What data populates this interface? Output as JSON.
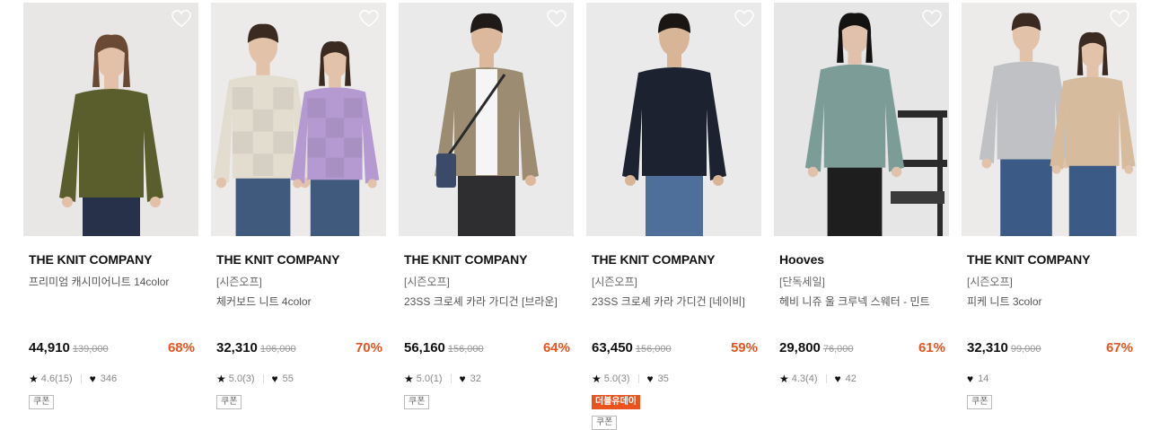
{
  "products": [
    {
      "brand": "THE KNIT COMPANY",
      "tag": "",
      "name": "프리미엄 캐시미어니트 14color",
      "price": "44,910",
      "original": "139,000",
      "discount": "68%",
      "rating": "4.6(15)",
      "likes": "346",
      "badges": [
        "쿠폰"
      ],
      "colors": {
        "bg": "#e9e7e6",
        "garment": "#5a5e2c",
        "pants": "#27314a",
        "skin": "#e3c0a8",
        "hair": "#6b4a35"
      }
    },
    {
      "brand": "THE KNIT COMPANY",
      "tag": "[시즌오프]",
      "name": "체커보드 니트 4color",
      "price": "32,310",
      "original": "106,000",
      "discount": "70%",
      "rating": "5.0(3)",
      "likes": "55",
      "badges": [
        "쿠폰"
      ],
      "colors": {
        "bg": "#ecebea",
        "garment": "#e3ddd0",
        "garment2": "#b49ad0",
        "pants": "#3f5a7d",
        "skin": "#e3c2aa",
        "hair": "#3a2a20"
      }
    },
    {
      "brand": "THE KNIT COMPANY",
      "tag": "[시즌오프]",
      "name": "23SS 크로셰 카라 가디건 [브라운]",
      "price": "56,160",
      "original": "156,000",
      "discount": "64%",
      "rating": "5.0(1)",
      "likes": "32",
      "badges": [
        "쿠폰"
      ],
      "colors": {
        "bg": "#ebeaea",
        "garment": "#9c8c72",
        "inner": "#f5f5f5",
        "pants": "#2e2e30",
        "skin": "#dcb99c",
        "hair": "#1f1a18"
      }
    },
    {
      "brand": "THE KNIT COMPANY",
      "tag": "[시즌오프]",
      "name": "23SS 크로셰 카라 가디건 [네이비]",
      "price": "63,450",
      "original": "156,000",
      "discount": "59%",
      "rating": "5.0(3)",
      "likes": "35",
      "badges": [
        "더블유데이",
        "쿠폰"
      ],
      "colors": {
        "bg": "#ebeaea",
        "garment": "#1c2230",
        "pants": "#4d6f9a",
        "skin": "#d9b598",
        "hair": "#1a1614"
      }
    },
    {
      "brand": "Hooves",
      "tag": "[단독세일]",
      "name": "헤비 니쥬 울 크루넥 스웨터 - 민트",
      "price": "29,800",
      "original": "76,000",
      "discount": "61%",
      "rating": "4.3(4)",
      "likes": "42",
      "badges": [],
      "colors": {
        "bg": "#e6e6e6",
        "garment": "#7c9c98",
        "pants": "#1e1e1e",
        "skin": "#e0c2ac",
        "hair": "#151212",
        "chair": "#2b2b2b"
      }
    },
    {
      "brand": "THE KNIT COMPANY",
      "tag": "[시즌오프]",
      "name": "피케 니트 3color",
      "price": "32,310",
      "original": "99,000",
      "discount": "67%",
      "rating": "",
      "likes": "14",
      "badges": [
        "쿠폰"
      ],
      "colors": {
        "bg": "#ecebea",
        "garment": "#bfc1c4",
        "garment2": "#d6bc9c",
        "pants": "#3b5a86",
        "skin": "#e3c2aa",
        "hair": "#3a2a20"
      }
    }
  ]
}
